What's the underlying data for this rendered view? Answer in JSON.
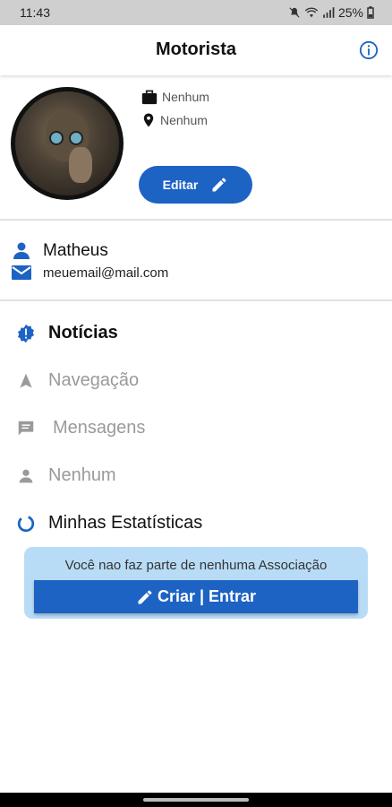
{
  "status_bar": {
    "time": "11:43",
    "battery": "25%"
  },
  "header": {
    "title": "Motorista"
  },
  "profile": {
    "vehicle": "Nenhum",
    "location": "Nenhum",
    "edit_label": "Editar"
  },
  "user": {
    "name": "Matheus",
    "email": "meuemail@mail.com"
  },
  "menu": [
    {
      "label": "Notícias",
      "icon": "news-badge-icon",
      "color": "#111111"
    },
    {
      "label": "Navegação",
      "icon": "navigation-arrow-icon",
      "color": "#9a9a9a"
    },
    {
      "label": "Mensagens",
      "icon": "message-icon",
      "color": "#9a9a9a"
    },
    {
      "label": "Nenhum",
      "icon": "person-icon",
      "color": "#9a9a9a"
    },
    {
      "label": "Minhas Estatísticas",
      "icon": "donut-chart-icon",
      "color": "#111111"
    }
  ],
  "association": {
    "message": "Você nao faz parte de nenhuma Associação",
    "button_label": "Criar | Entrar"
  },
  "colors": {
    "primary": "#1d63c4",
    "card_bg": "#b9dcf6"
  }
}
